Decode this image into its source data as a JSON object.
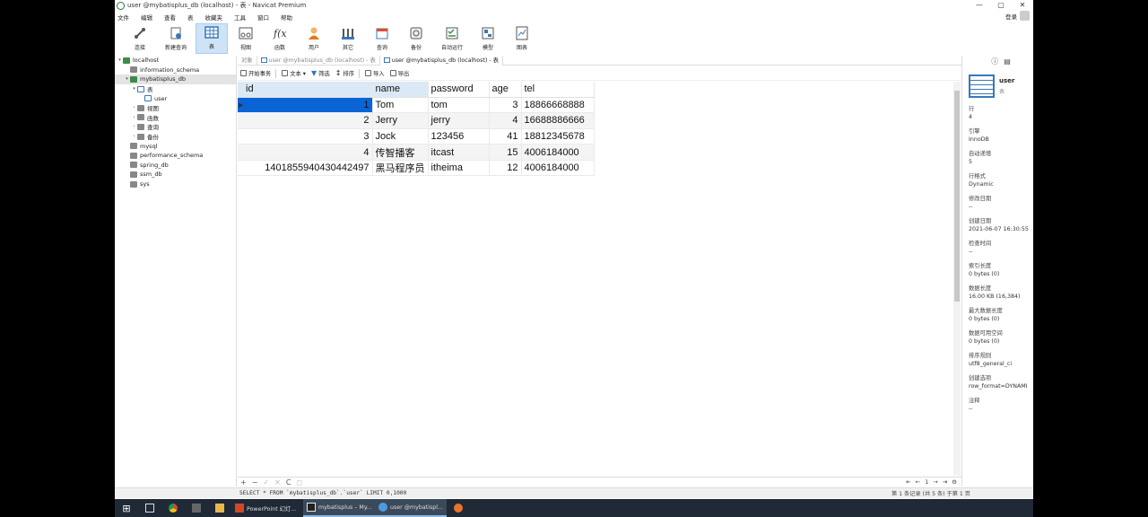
{
  "window": {
    "title": "user @mybatisplus_db (localhost) - 表 - Navicat Premium",
    "controls": [
      "—",
      "▢",
      "✕"
    ]
  },
  "menu": [
    "文件",
    "编辑",
    "查看",
    "表",
    "收藏夹",
    "工具",
    "窗口",
    "帮助"
  ],
  "login": {
    "label": "登录"
  },
  "toolbar": [
    {
      "label": "连接",
      "icon": "connection-icon"
    },
    {
      "label": "新建查询",
      "icon": "new-query-icon"
    },
    {
      "label": "表",
      "icon": "table-icon",
      "active": true
    },
    {
      "label": "视图",
      "icon": "view-icon"
    },
    {
      "label": "函数",
      "icon": "function-icon"
    },
    {
      "label": "用户",
      "icon": "user-icon"
    },
    {
      "label": "其它",
      "icon": "other-icon"
    },
    {
      "label": "查询",
      "icon": "query-icon"
    },
    {
      "label": "备份",
      "icon": "backup-icon"
    },
    {
      "label": "自动运行",
      "icon": "automation-icon"
    },
    {
      "label": "模型",
      "icon": "model-icon"
    },
    {
      "label": "图表",
      "icon": "chart-icon"
    }
  ],
  "tree": {
    "nodes": [
      {
        "label": "localhost",
        "level": 0,
        "toggle": "▾",
        "icon": "server-icon"
      },
      {
        "label": "information_schema",
        "level": 1,
        "toggle": "",
        "icon": "database-icon"
      },
      {
        "label": "mybatisplus_db",
        "level": 1,
        "toggle": "▾",
        "icon": "database-open-icon",
        "selected": true
      },
      {
        "label": "表",
        "level": 2,
        "toggle": "▾",
        "icon": "tables-folder-icon"
      },
      {
        "label": "user",
        "level": 3,
        "toggle": "",
        "icon": "table-icon"
      },
      {
        "label": "视图",
        "level": 2,
        "toggle": "›",
        "icon": "views-folder-icon"
      },
      {
        "label": "函数",
        "level": 2,
        "toggle": "›",
        "icon": "functions-folder-icon"
      },
      {
        "label": "查询",
        "level": 2,
        "toggle": "›",
        "icon": "queries-folder-icon"
      },
      {
        "label": "备份",
        "level": 2,
        "toggle": "›",
        "icon": "backups-folder-icon"
      },
      {
        "label": "mysql",
        "level": 1,
        "toggle": "",
        "icon": "database-icon"
      },
      {
        "label": "performance_schema",
        "level": 1,
        "toggle": "",
        "icon": "database-icon"
      },
      {
        "label": "spring_db",
        "level": 1,
        "toggle": "",
        "icon": "database-icon"
      },
      {
        "label": "ssm_db",
        "level": 1,
        "toggle": "",
        "icon": "database-icon"
      },
      {
        "label": "sys",
        "level": 1,
        "toggle": "",
        "icon": "database-icon"
      }
    ]
  },
  "tabs": [
    {
      "label": "对象",
      "active": false
    },
    {
      "label": "user @mybatisplus_db (localhost) - 表",
      "active": false
    },
    {
      "label": "user @mybatisplus_db (localhost) - 表",
      "active": true
    }
  ],
  "objbar": [
    {
      "label": "开始事务",
      "icon": "transaction-icon"
    },
    {
      "label": "文本 ▾",
      "icon": "text-icon"
    },
    {
      "label": "筛选",
      "icon": "filter-icon"
    },
    {
      "label": "排序",
      "icon": "sort-icon"
    },
    {
      "label": "导入",
      "icon": "import-icon"
    },
    {
      "label": "导出",
      "icon": "export-icon"
    }
  ],
  "grid": {
    "columns": [
      "id",
      "name",
      "password",
      "age",
      "tel"
    ],
    "rows": [
      [
        "1",
        "Tom",
        "tom",
        "3",
        "18866668888"
      ],
      [
        "2",
        "Jerry",
        "jerry",
        "4",
        "16688886666"
      ],
      [
        "3",
        "Jock",
        "123456",
        "41",
        "18812345678"
      ],
      [
        "4",
        "传智播客",
        "itcast",
        "15",
        "4006184000"
      ],
      [
        "1401855940430442497",
        "黑马程序员",
        "itheima",
        "12",
        "4006184000"
      ]
    ]
  },
  "navbar": [
    "+",
    "−",
    "✓",
    "✕",
    "C",
    "◻"
  ],
  "pager": [
    "⇤",
    "←",
    "1",
    "→",
    "⇥",
    "⚙"
  ],
  "status": {
    "sql": "SELECT * FROM `mybatisplus_db`.`user` LIMIT 0,1000",
    "records": "第 1 条记录 (共 5 条) 于第 1 页"
  },
  "info": {
    "name": "user",
    "type": "表",
    "properties": [
      {
        "k": "行",
        "v": "4"
      },
      {
        "k": "引擎",
        "v": "InnoDB"
      },
      {
        "k": "自动递增",
        "v": "5"
      },
      {
        "k": "行格式",
        "v": "Dynamic"
      },
      {
        "k": "修改日期",
        "v": "--"
      },
      {
        "k": "创建日期",
        "v": "2021-06-07 16:30:55"
      },
      {
        "k": "检查时间",
        "v": "--"
      },
      {
        "k": "索引长度",
        "v": "0 bytes (0)"
      },
      {
        "k": "数据长度",
        "v": "16.00 KB (16,384)"
      },
      {
        "k": "最大数据长度",
        "v": "0 bytes (0)"
      },
      {
        "k": "数据可用空间",
        "v": "0 bytes (0)"
      },
      {
        "k": "排序规则",
        "v": "utf8_general_ci"
      },
      {
        "k": "创建选项",
        "v": "row_format=DYNAMI"
      },
      {
        "k": "注释",
        "v": "--"
      }
    ]
  },
  "taskbar": {
    "apps": [
      {
        "label": "PowerPoint 幻灯...",
        "color": "#d24726",
        "active": false
      },
      {
        "label": "mybatisplus – My...",
        "color": "#e8e8e8",
        "active": true
      },
      {
        "label": "user @mybatispl...",
        "color": "#4d9ae0",
        "active": true
      }
    ]
  }
}
